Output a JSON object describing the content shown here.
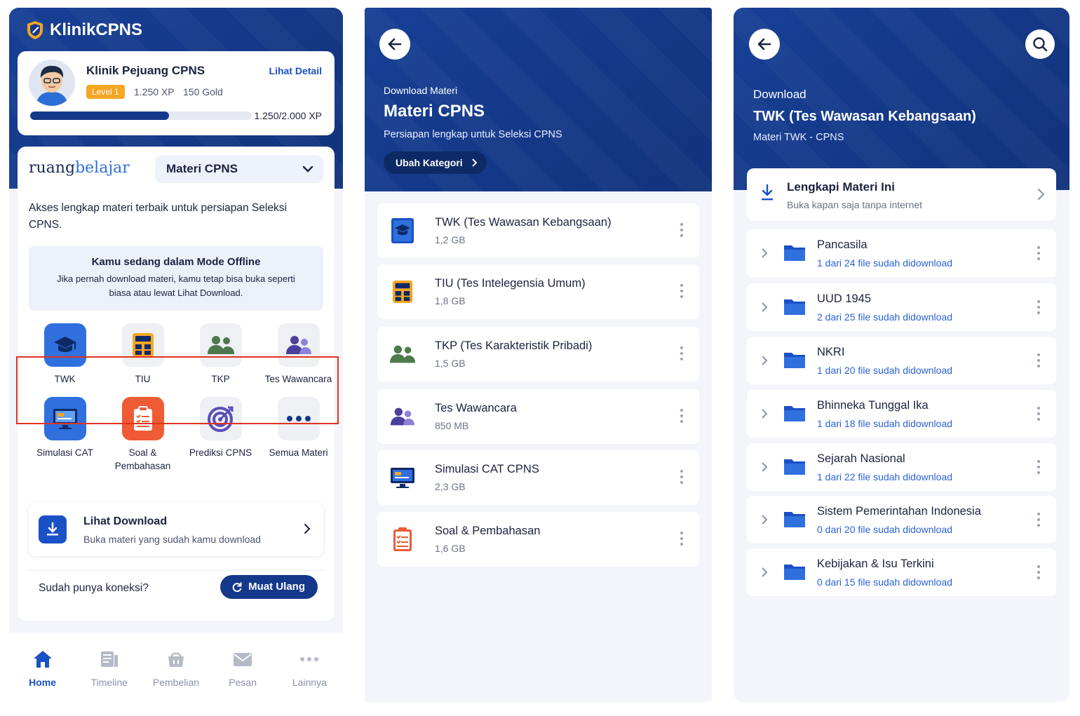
{
  "colors": {
    "primary": "#15398a",
    "accent": "#1a51c4",
    "highlight": "#e0321f",
    "level": "#f5a623"
  },
  "screen1": {
    "app_name": "KlinikCPNS",
    "profile": {
      "name": "Klinik Pejuang CPNS",
      "detail_link": "Lihat Detail",
      "level": "Level 1",
      "xp": "1.250 XP",
      "gold": "150 Gold",
      "progress_text": "1.250/2.000 XP",
      "progress_fraction": 0.625
    },
    "ruangbelajar": {
      "logo_a": "ruang",
      "logo_b": "belajar",
      "selected_category": "Materi CPNS",
      "description": "Akses lengkap materi terbaik untuk persiapan Seleksi CPNS.",
      "offline_title": "Kamu sedang dalam Mode Offline",
      "offline_text": "Jika pernah download materi, kamu tetap bisa buka seperti biasa atau lewat Lihat Download."
    },
    "tiles": [
      {
        "label": "TWK",
        "icon": "graduation-cap-icon"
      },
      {
        "label": "TIU",
        "icon": "calculator-icon"
      },
      {
        "label": "TKP",
        "icon": "people-icon"
      },
      {
        "label": "Tes Wawancara",
        "icon": "interview-people-icon"
      },
      {
        "label": "Simulasi CAT",
        "icon": "monitor-icon"
      },
      {
        "label": "Soal & Pembahasan",
        "icon": "clipboard-icon"
      },
      {
        "label": "Prediksi CPNS",
        "icon": "target-icon"
      },
      {
        "label": "Semua Materi",
        "icon": "more-dots-icon"
      }
    ],
    "download": {
      "title": "Lihat Download",
      "subtitle": "Buka materi yang sudah kamu download"
    },
    "reload": {
      "question": "Sudah punya koneksi?",
      "button": "Muat Ulang"
    },
    "tabs": [
      {
        "label": "Home",
        "icon": "home-icon",
        "active": true
      },
      {
        "label": "Timeline",
        "icon": "timeline-icon",
        "active": false
      },
      {
        "label": "Pembelian",
        "icon": "basket-icon",
        "active": false
      },
      {
        "label": "Pesan",
        "icon": "mail-icon",
        "active": false
      },
      {
        "label": "Lainnya",
        "icon": "more-icon",
        "active": false
      }
    ]
  },
  "screen2": {
    "eyebrow": "Download Materi",
    "title": "Materi CPNS",
    "subtitle": "Persiapan lengkap untuk Seleksi CPNS",
    "chip": "Ubah Kategori",
    "items": [
      {
        "title": "TWK (Tes Wawasan Kebangsaan)",
        "size": "1,2 GB",
        "icon": "graduation-book-icon"
      },
      {
        "title": "TIU (Tes Intelegensia Umum)",
        "size": "1,8 GB",
        "icon": "calculator-icon"
      },
      {
        "title": "TKP (Tes Karakteristik Pribadi)",
        "size": "1,5 GB",
        "icon": "people-icon"
      },
      {
        "title": "Tes Wawancara",
        "size": "850 MB",
        "icon": "interview-people-icon"
      },
      {
        "title": "Simulasi CAT CPNS",
        "size": "2,3 GB",
        "icon": "monitor-icon"
      },
      {
        "title": "Soal & Pembahasan",
        "size": "1,6 GB",
        "icon": "clipboard-icon"
      }
    ]
  },
  "screen3": {
    "eyebrow": "Download",
    "title": "TWK (Tes Wawasan Kebangsaan)",
    "subtitle": "Materi TWK - CPNS",
    "lengkapi": {
      "title": "Lengkapi Materi Ini",
      "subtitle": "Buka kapan saja tanpa internet"
    },
    "folders": [
      {
        "title": "Pancasila",
        "status": "1 dari 24 file sudah didownload"
      },
      {
        "title": "UUD 1945",
        "status": "2 dari 25 file sudah didownload"
      },
      {
        "title": "NKRI",
        "status": "1 dari 20 file sudah didownload"
      },
      {
        "title": "Bhinneka Tunggal Ika",
        "status": "1 dari 18 file sudah didownload"
      },
      {
        "title": "Sejarah Nasional",
        "status": "1 dari 22 file sudah didownload"
      },
      {
        "title": "Sistem Pemerintahan Indonesia",
        "status": "0 dari 20 file sudah didownload"
      },
      {
        "title": "Kebijakan & Isu Terkini",
        "status": "0 dari 15 file sudah didownload"
      }
    ]
  }
}
